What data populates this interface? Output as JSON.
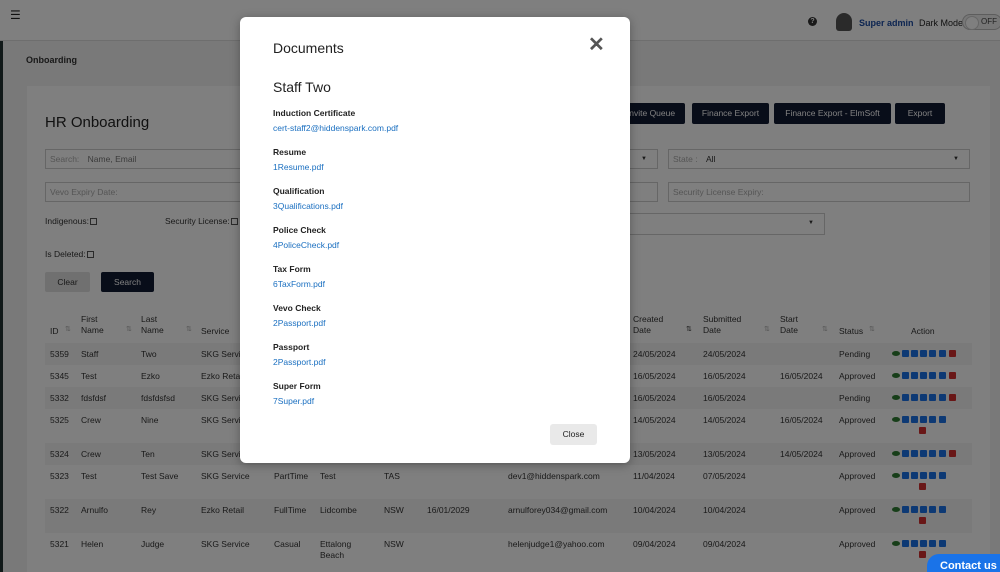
{
  "topbar": {
    "menu_icon": "hamburger-icon",
    "help_icon": "question-icon",
    "user_name": "Super admin",
    "dark_mode_label": "Dark Mode",
    "dark_mode_state": "OFF"
  },
  "breadcrumb": "Onboarding",
  "page": {
    "title": "HR Onboarding",
    "buttons": {
      "invite_queue": "Invite Queue",
      "finance_export": "Finance Export",
      "finance_export_elmsoft": "Finance Export - ElmSoft",
      "export": "Export"
    },
    "filters": {
      "search_label": "Search:",
      "search_placeholder": "Name, Email",
      "state_label": "State :",
      "state_value": "All",
      "vevo_placeholder": "Vevo Expiry Date:",
      "security_license_placeholder": "Security License Expiry:",
      "indigenous_label": "Indigenous:",
      "security_license_label": "Security License:",
      "is_deleted_label": "Is Deleted:",
      "clear_label": "Clear",
      "search_button_label": "Search"
    },
    "table": {
      "headers": {
        "id": "ID",
        "first_name_1": "First",
        "first_name_2": "Name",
        "last_name_1": "Last",
        "last_name_2": "Name",
        "service": "Service",
        "created_1": "Created",
        "created_2": "Date",
        "submitted_1": "Submitted",
        "submitted_2": "Date",
        "start_1": "Start",
        "start_2": "Date",
        "status": "Status",
        "action": "Action"
      },
      "rows": [
        {
          "id": "5359",
          "first": "Staff",
          "last": "Two",
          "service": "SKG Servi",
          "type": "",
          "suburb": "",
          "state": "",
          "expiry": "",
          "email": "",
          "created": "24/05/2024",
          "submitted": "24/05/2024",
          "start": "",
          "status": "Pending"
        },
        {
          "id": "5345",
          "first": "Test",
          "last": "Ezko",
          "service": "Ezko Retai",
          "type": "",
          "suburb": "",
          "state": "",
          "expiry": "",
          "email": "",
          "created": "16/05/2024",
          "submitted": "16/05/2024",
          "start": "16/05/2024",
          "status": "Approved"
        },
        {
          "id": "5332",
          "first": "fdsfdsf",
          "last": "fdsfdsfsd",
          "service": "SKG Servi",
          "type": "",
          "suburb": "",
          "state": "",
          "expiry": "",
          "email": "",
          "created": "16/05/2024",
          "submitted": "16/05/2024",
          "start": "",
          "status": "Pending"
        },
        {
          "id": "5325",
          "first": "Crew",
          "last": "Nine",
          "service": "SKG Servi",
          "type": "",
          "suburb": "",
          "state": "",
          "expiry": "",
          "email": "",
          "created": "14/05/2024",
          "submitted": "14/05/2024",
          "start": "16/05/2024",
          "status": "Approved"
        },
        {
          "id": "5324",
          "first": "Crew",
          "last": "Ten",
          "service": "SKG Servi",
          "type": "",
          "suburb": "",
          "state": "",
          "expiry": "",
          "email": "",
          "created": "13/05/2024",
          "submitted": "13/05/2024",
          "start": "14/05/2024",
          "status": "Approved"
        },
        {
          "id": "5323",
          "first": "Test",
          "last": "Test Save",
          "service": "SKG Service",
          "type": "PartTime",
          "suburb": "Test",
          "state": "TAS",
          "expiry": "",
          "email": "dev1@hiddenspark.com",
          "created": "11/04/2024",
          "submitted": "07/05/2024",
          "start": "",
          "status": "Approved"
        },
        {
          "id": "5322",
          "first": "Arnulfo",
          "last": "Rey",
          "service": "Ezko Retail",
          "type": "FullTime",
          "suburb": "Lidcombe",
          "state": "NSW",
          "expiry": "16/01/2029",
          "email": "arnulforey034@gmail.com",
          "created": "10/04/2024",
          "submitted": "10/04/2024",
          "start": "",
          "status": "Approved"
        },
        {
          "id": "5321",
          "first": "Helen",
          "last": "Judge",
          "service": "SKG Service",
          "type": "Casual",
          "suburb": "Ettalong",
          "suburb2": "Beach",
          "state": "NSW",
          "expiry": "",
          "email": "helenjudge1@yahoo.com",
          "created": "09/04/2024",
          "submitted": "09/04/2024",
          "start": "",
          "status": "Approved"
        }
      ]
    }
  },
  "modal": {
    "title": "Documents",
    "close_icon": "close-icon",
    "staff_name": "Staff Two",
    "documents": [
      {
        "label": "Induction Certificate",
        "file": "cert-staff2@hiddenspark.com.pdf"
      },
      {
        "label": "Resume",
        "file": "1Resume.pdf"
      },
      {
        "label": "Qualification",
        "file": "3Qualifications.pdf"
      },
      {
        "label": "Police Check",
        "file": "4PoliceCheck.pdf"
      },
      {
        "label": "Tax Form",
        "file": "6TaxForm.pdf"
      },
      {
        "label": "Vevo Check",
        "file": "2Passport.pdf"
      },
      {
        "label": "Passport",
        "file": "2Passport.pdf"
      },
      {
        "label": "Super Form",
        "file": "7Super.pdf"
      }
    ],
    "close_button": "Close"
  },
  "contact_button": "Contact us",
  "colors": {
    "navy": "#111a33",
    "link": "#1a6fc0",
    "icon_view": "#2e7d32",
    "icon_blue": "#1a73e8",
    "icon_delete": "#d32f2f"
  }
}
